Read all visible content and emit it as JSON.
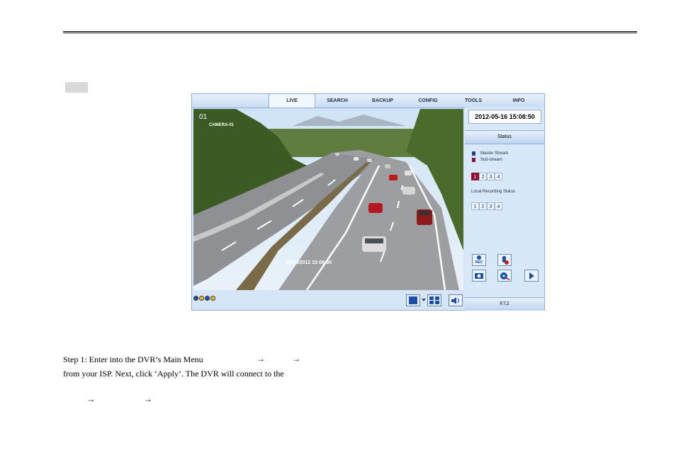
{
  "dvr": {
    "tabs": [
      "LIVE",
      "SEARCH",
      "BACKUP",
      "CONFIG",
      "TOOLS",
      "INFO"
    ],
    "active_tab": "LIVE",
    "video": {
      "channel_number": "01",
      "camera_name": "CAMERA-01",
      "timestamp_overlay": "05/16/2012 15:08:50"
    },
    "side": {
      "datetime": "2012-05-16 15:08:50",
      "status_header": "Status",
      "legend": {
        "master": "Master Stream",
        "sub": "Sub-stream",
        "master_color": "#2e3e8e",
        "sub_color": "#8b1233"
      },
      "live_channels": [
        "1",
        "2",
        "3",
        "4"
      ],
      "active_channel": "1",
      "local_recording_label": "Local Recording Status",
      "record_channels": [
        "1",
        "2",
        "3",
        "4"
      ],
      "record_button_label": "REC",
      "ptz_label": "P.T.Z"
    }
  },
  "text": {
    "step1_line1": "Step 1: Enter into the DVR’s Main Menu",
    "step1_line2": "from your ISP. Next, click ‘Apply’. The DVR will connect to the"
  }
}
